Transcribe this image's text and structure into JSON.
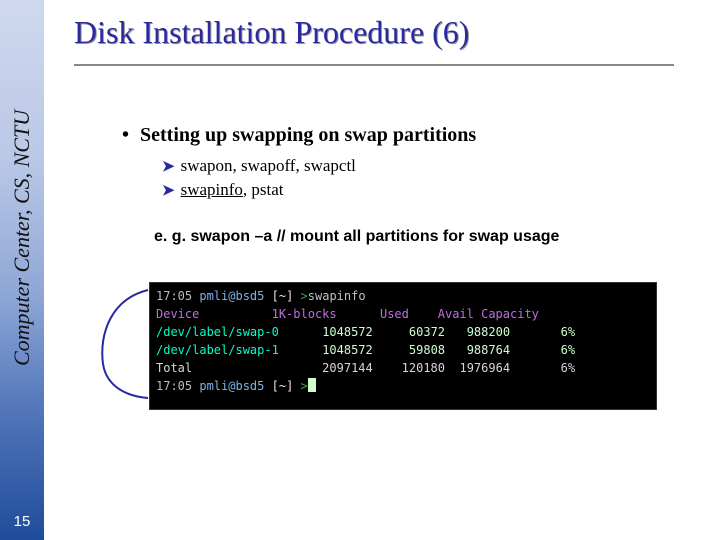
{
  "rail_text": "Computer Center, CS, NCTU",
  "page_number": "15",
  "title": "Disk Installation Procedure (6)",
  "bullets": {
    "main": "Setting up swapping on swap partitions",
    "sub1": "swapon, swapoff, swapctl",
    "sub2_underlined": "swapinfo",
    "sub2_rest": ", pstat"
  },
  "example": "e. g. swapon –a // mount all partitions for swap usage",
  "terminal": {
    "prompt_time": "17:05",
    "prompt_userhost": "pmli@bsd5",
    "prompt_path": "[~]",
    "prompt_char": ">",
    "cmd": "swapinfo",
    "header": "Device          1K-blocks      Used    Avail Capacity",
    "rows": [
      {
        "dev": "/dev/label/swap-0",
        "kb": "1048572",
        "used": "60372",
        "avail": "988200",
        "cap": "6%"
      },
      {
        "dev": "/dev/label/swap-1",
        "kb": "1048572",
        "used": "59808",
        "avail": "988764",
        "cap": "6%"
      }
    ],
    "total": {
      "label": "Total",
      "kb": "2097144",
      "used": "120180",
      "avail": "1976964",
      "cap": "6%"
    }
  }
}
